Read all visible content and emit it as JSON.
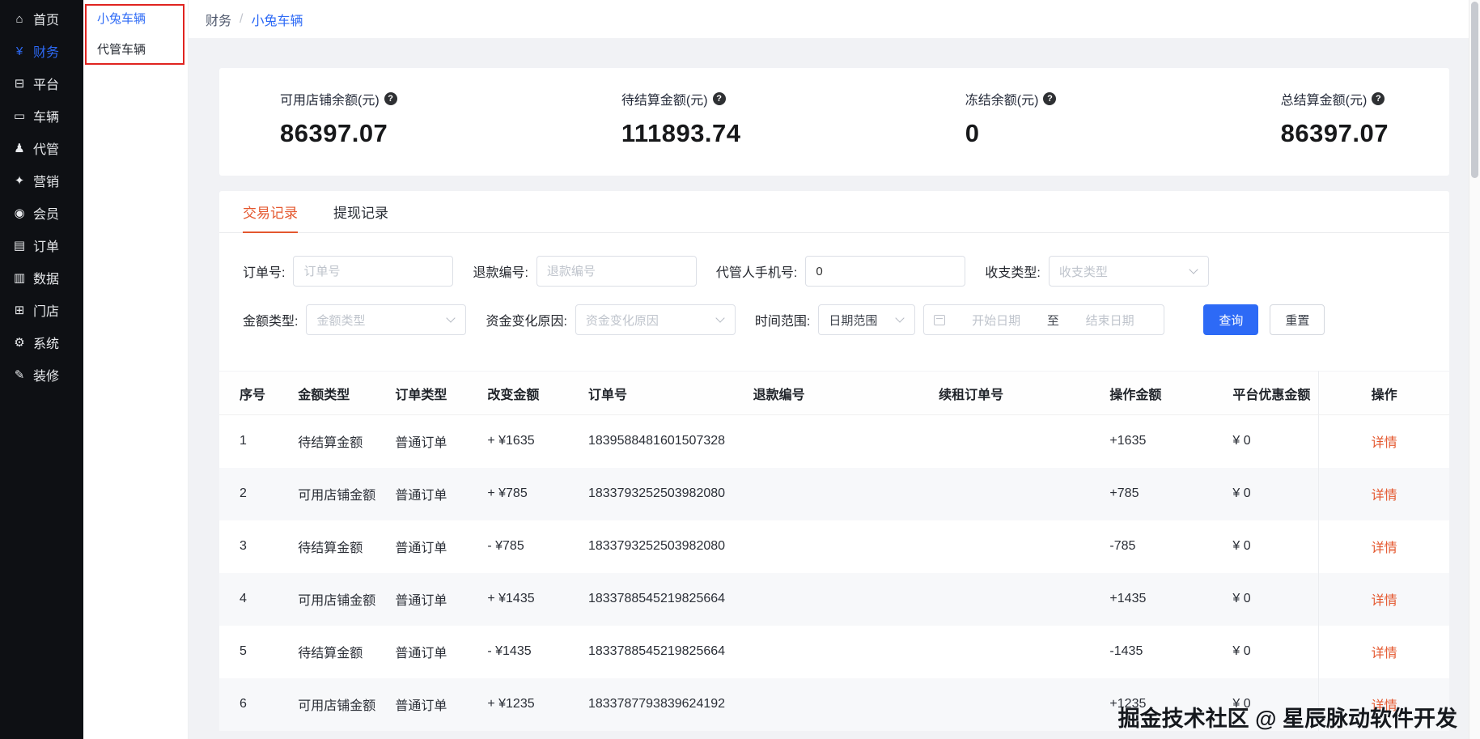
{
  "colors": {
    "primary_blue": "#2d6af6",
    "active_orange": "#e4572e",
    "annotation_red": "#e02420",
    "sidebar_bg": "#0e1014"
  },
  "sidebar": {
    "items": [
      {
        "icon": "home-icon",
        "glyph": "⌂",
        "label": "首页"
      },
      {
        "icon": "finance-icon",
        "glyph": "¥",
        "label": "财务",
        "active": true
      },
      {
        "icon": "platform-icon",
        "glyph": "⊟",
        "label": "平台"
      },
      {
        "icon": "vehicle-icon",
        "glyph": "▭",
        "label": "车辆"
      },
      {
        "icon": "escrow-icon",
        "glyph": "♟",
        "label": "代管"
      },
      {
        "icon": "marketing-icon",
        "glyph": "✦",
        "label": "营销"
      },
      {
        "icon": "member-icon",
        "glyph": "◉",
        "label": "会员"
      },
      {
        "icon": "order-icon",
        "glyph": "▤",
        "label": "订单"
      },
      {
        "icon": "data-icon",
        "glyph": "▥",
        "label": "数据"
      },
      {
        "icon": "store-icon",
        "glyph": "⊞",
        "label": "门店"
      },
      {
        "icon": "system-icon",
        "glyph": "⚙",
        "label": "系统"
      },
      {
        "icon": "decorate-icon",
        "glyph": "✎",
        "label": "装修"
      }
    ]
  },
  "submenu": {
    "items": [
      {
        "label": "小兔车辆",
        "active": true
      },
      {
        "label": "代管车辆"
      }
    ]
  },
  "breadcrumb": {
    "parent": "财务",
    "separator": "/",
    "current": "小兔车辆"
  },
  "stats": {
    "items": [
      {
        "label": "可用店铺余额(元)",
        "value": "86397.07"
      },
      {
        "label": "待结算金额(元)",
        "value": "111893.74"
      },
      {
        "label": "冻结余额(元)",
        "value": "0"
      },
      {
        "label": "总结算金额(元)",
        "value": "86397.07"
      }
    ]
  },
  "tabs": {
    "items": [
      {
        "label": "交易记录",
        "active": true
      },
      {
        "label": "提现记录"
      }
    ]
  },
  "filters": {
    "order_no": {
      "label": "订单号:",
      "placeholder": "订单号"
    },
    "refund_no": {
      "label": "退款编号:",
      "placeholder": "退款编号"
    },
    "phone": {
      "label": "代管人手机号:",
      "value": "0"
    },
    "income_type": {
      "label": "收支类型:",
      "placeholder": "收支类型"
    },
    "amount_type": {
      "label": "金额类型:",
      "placeholder": "金额类型"
    },
    "change_reason": {
      "label": "资金变化原因:",
      "placeholder": "资金变化原因"
    },
    "time_range": {
      "label": "时间范围:",
      "range_placeholder": "日期范围",
      "start_placeholder": "开始日期",
      "to": "至",
      "end_placeholder": "结束日期"
    },
    "search_button": "查询",
    "reset_button": "重置"
  },
  "table": {
    "headers": [
      {
        "label": "序号"
      },
      {
        "label": "金额类型"
      },
      {
        "label": "订单类型"
      },
      {
        "label": "改变金额"
      },
      {
        "label": "订单号"
      },
      {
        "label": "退款编号"
      },
      {
        "label": "续租订单号"
      },
      {
        "label": "操作金额"
      },
      {
        "label": "平台优惠金额"
      },
      {
        "label": "操作"
      }
    ],
    "rows": [
      {
        "index": "1",
        "amount_type": "待结算金额",
        "order_type": "普通订单",
        "change": "+ ¥1635",
        "order_no": "1839588481601507328",
        "refund_no": "",
        "renew_order_no": "",
        "op_amount": "+1635",
        "platform_discount": "¥ 0",
        "action": "详情"
      },
      {
        "index": "2",
        "amount_type": "可用店铺金额",
        "order_type": "普通订单",
        "change": "+ ¥785",
        "order_no": "1833793252503982080",
        "refund_no": "",
        "renew_order_no": "",
        "op_amount": "+785",
        "platform_discount": "¥ 0",
        "action": "详情"
      },
      {
        "index": "3",
        "amount_type": "待结算金额",
        "order_type": "普通订单",
        "change": "- ¥785",
        "order_no": "1833793252503982080",
        "refund_no": "",
        "renew_order_no": "",
        "op_amount": "-785",
        "platform_discount": "¥ 0",
        "action": "详情"
      },
      {
        "index": "4",
        "amount_type": "可用店铺金额",
        "order_type": "普通订单",
        "change": "+ ¥1435",
        "order_no": "1833788545219825664",
        "refund_no": "",
        "renew_order_no": "",
        "op_amount": "+1435",
        "platform_discount": "¥ 0",
        "action": "详情"
      },
      {
        "index": "5",
        "amount_type": "待结算金额",
        "order_type": "普通订单",
        "change": "- ¥1435",
        "order_no": "1833788545219825664",
        "refund_no": "",
        "renew_order_no": "",
        "op_amount": "-1435",
        "platform_discount": "¥ 0",
        "action": "详情"
      },
      {
        "index": "6",
        "amount_type": "可用店铺金额",
        "order_type": "普通订单",
        "change": "+ ¥1235",
        "order_no": "1833787793839624192",
        "refund_no": "",
        "renew_order_no": "",
        "op_amount": "+1235",
        "platform_discount": "¥ 0",
        "action": "详情"
      }
    ]
  },
  "watermark": "掘金技术社区 @ 星辰脉动软件开发"
}
